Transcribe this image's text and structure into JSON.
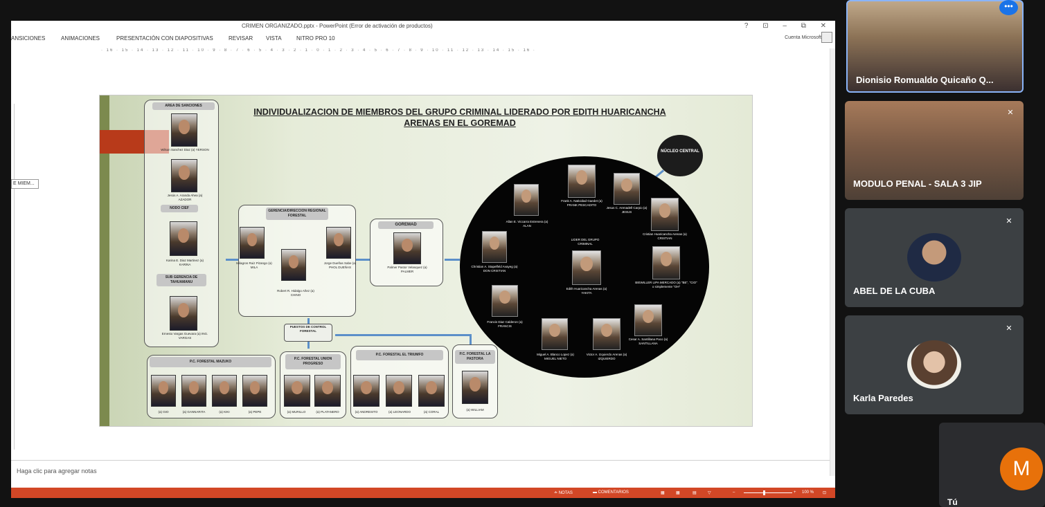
{
  "ppt": {
    "title": "CRIMEN ORGANIZADO.pptx - PowerPoint (Error de activación de productos)",
    "window_controls": "? ⊡ – ⧉ ✕",
    "ribbon_tabs": [
      "ANSICIONES",
      "ANIMACIONES",
      "PRESENTACIÓN CON DIAPOSITIVAS",
      "REVISAR",
      "VISTA",
      "NITRO PRO 10"
    ],
    "account": "Cuenta Microsoft",
    "ruler": "· 16 · 15 · 14 · 13 · 12 · 11 · 10 · 9 · 8 · 7 · 6 · 5 · 4 · 3 · 2 · 1 · 0 · 1 · 2 · 3 · 4 · 5 · 6 · 7 · 8 · 9 · 10 · 11 · 12 · 13 · 14 · 15 · 16 ·",
    "thumbnail_label": "E MIEM...",
    "notes_placeholder": "Haga clic para agregar notas",
    "status": {
      "notes": "≐ NOTAS",
      "comments": "▬ COMENTARIOS",
      "zoom": "100 %"
    }
  },
  "slide": {
    "title": "INDIVIDUALIZACION DE MIEMBROS DEL GRUPO CRIMINAL LIDERADO POR EDITH HUARICANCHA ARENAS EN EL GOREMAD",
    "left_column": {
      "header1": "AREA DE SANCIONES",
      "p1": "Wilson Sanchez Diaz (a) YERSON",
      "p2": "Jesús A. Aranda Ahea (a) AZADOR",
      "header2": "NODO CIEF",
      "p3": "Karina E. Diaz Martinez (a) KARINA",
      "header3": "SUB GERENCIA DE TAHUAMANU",
      "p4": "Ernesto Vargas Guevara (a) ING. VARGAS"
    },
    "gerencia": {
      "header": "GERENCIA/DIRECCION REGIONAL FORESTAL",
      "p1": "Milagros Ruiz Pizango (a) MILA",
      "p2": "Robert R. Hidalgo Añez (a) CHINO",
      "p3": "Jorge Dueñas Sabe (a) PHOL DUEÑAS"
    },
    "goremad": {
      "header": "GOREMAD",
      "p1": "Palmer Pastor Velasquez (a) PALMER"
    },
    "puestos": "PUESTOS DE CONTROL FORESTAL",
    "pc1": {
      "header": "P.C. FORESTAL MAZUKO",
      "labels": [
        "(a) GIO",
        "(a) GANNARITA",
        "(a) KIKI",
        "(a) PEPE"
      ]
    },
    "pc2": {
      "header": "P.C. FORESTAL UNION PROGRESO",
      "labels": [
        "(a) MURILLO",
        "(a) PLATANERO"
      ]
    },
    "pc3": {
      "header": "P.C. FORESTAL EL TRIUMFO",
      "labels": [
        "(a) ANDRESITO",
        "(a) LEONARDO",
        "(a) CORAL"
      ]
    },
    "pc4": {
      "header": "P.C. FORESTAL LA PASTORA",
      "labels": [
        "(a) WILLIAM"
      ]
    },
    "nucleo": "NÚCLEO CENTRAL",
    "circle": {
      "allan": "Allan E. Viccarra Estrenera (a) ALAN",
      "frank": "Frank A. Natividad Gaedet (a) FRANK PESCADITO",
      "jesus": "Jesus C. Arenadell Carpio (a) JESUS",
      "cristian": "Cristian Huaricancha Arenas (a) CRISTIAN",
      "christian": "Christian A. Stapelfeld Avayeg (a) DON CRISTIAN",
      "lider_label": "LIDER DEL GRUPO CRIMINAL",
      "edith": "Edith Huaricancha Arenas (a) YAKITA",
      "biewiller": "BIEWILLER LIPA MERCADO (a) \"BE\", \"CIO\" o simplemente \"OH\"",
      "francis": "Francis Diaz Calderon (a) FRANCIS",
      "miguel": "Miguel A. Blanco Lopez (a) MIGUEL NIETO",
      "victor": "Victor A. Izquierdo Arenas (a) IZQUIERDO",
      "cesar": "Cesar A. Santillana Paco (a) SANTILLANA"
    }
  },
  "meet": {
    "tiles": [
      {
        "name": "Dionisio Romualdo Quicaño Q..."
      },
      {
        "name": "MODULO PENAL - SALA 3 JIP"
      },
      {
        "name": "ABEL DE LA CUBA"
      },
      {
        "name": "Karla Paredes"
      },
      {
        "name": "Tú",
        "initial": "M"
      }
    ],
    "more": "•••",
    "mic_off": "🎙̸"
  },
  "colors": {
    "accent": "#1a73e8",
    "ppt_status": "#d24726",
    "avatar_m": "#e8710a"
  }
}
